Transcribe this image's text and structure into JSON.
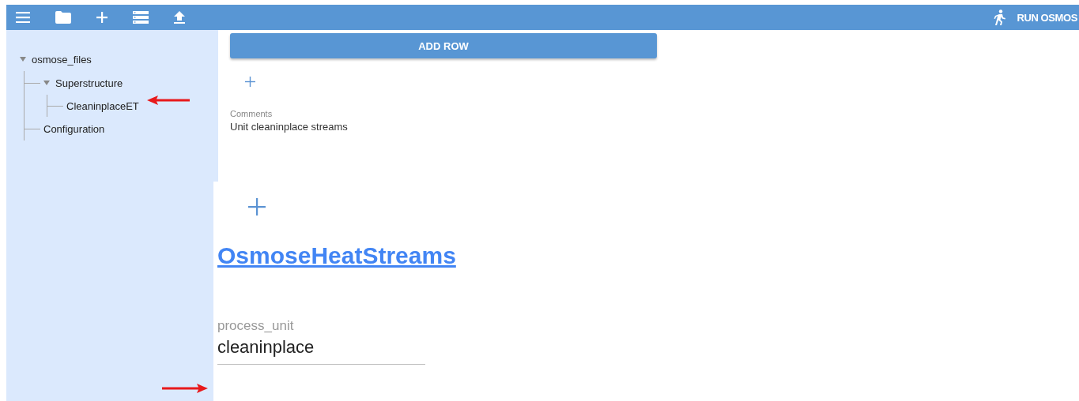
{
  "toolbar": {
    "run_button": "RUN OSMOS"
  },
  "tree": [
    {
      "label": "osmose_files",
      "expanded": true,
      "children": [
        {
          "label": "Superstructure",
          "expanded": true,
          "children": [
            {
              "label": "CleaninplaceET"
            }
          ]
        },
        {
          "label": "Configuration"
        }
      ]
    }
  ],
  "upper_panel": {
    "add_row_button": "ADD ROW",
    "comments": {
      "label": "Comments",
      "value": "Unit cleaninplace streams"
    }
  },
  "lower_panel": {
    "heading_link": "OsmoseHeatStreams",
    "process_unit": {
      "label": "process_unit",
      "value": "cleaninplace"
    }
  }
}
